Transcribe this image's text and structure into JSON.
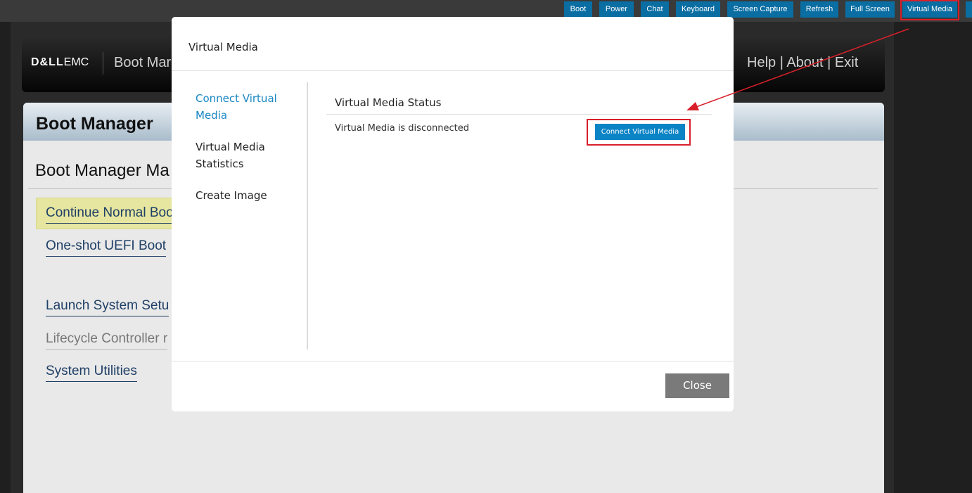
{
  "toolbar": {
    "buttons": [
      "Boot",
      "Power",
      "Chat",
      "Keyboard",
      "Screen Capture",
      "Refresh",
      "Full Screen",
      "Virtual Media"
    ]
  },
  "console": {
    "brand": {
      "logo_dell": "D&LL",
      "logo_emc": "EMC",
      "title": "Boot Mar",
      "help_links": "Help | About | Exit"
    },
    "panel_title": "Boot Manager",
    "section_title": "Boot Manager Ma",
    "menu": [
      {
        "label": "Continue Normal Boo"
      },
      {
        "label": "One-shot UEFI Boot"
      },
      {
        "label": "Launch System Setu"
      },
      {
        "label": "Lifecycle Controller r"
      },
      {
        "label": "System Utilities"
      }
    ]
  },
  "modal": {
    "title": "Virtual Media",
    "sidebar": [
      {
        "label": "Connect Virtual Media",
        "active": true
      },
      {
        "label": "Virtual Media Statistics",
        "active": false
      },
      {
        "label": "Create Image",
        "active": false
      }
    ],
    "status_title": "Virtual Media Status",
    "status_text": "Virtual Media is disconnected",
    "connect_button": "Connect Virtual Media",
    "close_button": "Close"
  },
  "colors": {
    "accent": "#0b84c6",
    "toolbar_button": "#0a6ea3",
    "annotation_red": "#d8202a"
  }
}
